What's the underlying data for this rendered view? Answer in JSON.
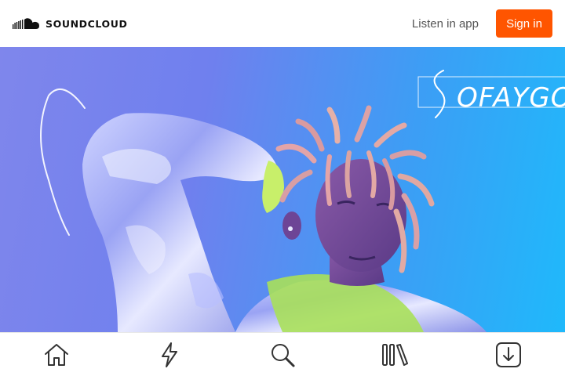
{
  "header": {
    "brand": "SOUNDCLOUD",
    "listen_label": "Listen in app",
    "signin_label": "Sign in"
  },
  "hero": {
    "artist_signature": "SOFAYGO"
  },
  "nav": {
    "items": [
      {
        "icon": "home-icon"
      },
      {
        "icon": "lightning-icon"
      },
      {
        "icon": "search-icon"
      },
      {
        "icon": "library-icon"
      },
      {
        "icon": "download-icon"
      }
    ]
  },
  "colors": {
    "accent": "#ff5500",
    "hero_start": "#7f86ec",
    "hero_end": "#1fb9fb"
  }
}
